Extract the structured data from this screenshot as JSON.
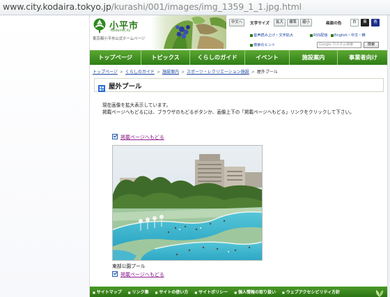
{
  "browser": {
    "url_host": "www.city.kodaira.tokyo.jp",
    "url_path": "/kurashi/001/images/img_1359_1_1.jpg.html"
  },
  "header": {
    "city_name": "小平市",
    "city_roman": "KodairaCity",
    "subtitle": "東京都小平市公式ホームページ",
    "tools": {
      "lang_button": "中文へ",
      "font_size_label": "文字サイズ",
      "font_large": "拡大",
      "font_standard": "標準",
      "font_small": "縮小",
      "color_label": "画面の色",
      "color_white": "白",
      "color_black": "黒",
      "color_blue": "青",
      "link_voice": "音声読み上げ・文字拡大",
      "link_rss": "RSS配信",
      "link_lang": "English・中文・韓",
      "link_search_hint": "検索のヒント",
      "search_placeholder": "Google カスタム検索",
      "search_button": "検索"
    }
  },
  "nav": {
    "items": [
      "トップページ",
      "トピックス",
      "くらしのガイド",
      "イベント",
      "施設案内",
      "事業者向け"
    ]
  },
  "breadcrumb": {
    "items": [
      "トップページ",
      "くらしのガイド",
      "施設案内",
      "スポーツ・レクリエーション施設"
    ],
    "current": "屋外プール"
  },
  "page_title": "屋外プール",
  "notice": {
    "line1": "現在画像を拡大表示しています。",
    "line2": "掲載ページへもどるには、ブラウザのもどるボタンか、画像上下の「掲載ページへもどる」リンクをクリックして下さい。"
  },
  "back_link_label": "掲載ページへもどる",
  "photo_caption": "東部公園プール",
  "footer": {
    "items": [
      "サイトマップ",
      "リンク集",
      "サイトの使い方",
      "サイトポリシー",
      "個人情報の取り扱い",
      "ウェブアクセシビリティ方針"
    ]
  },
  "colors": {
    "nav_green": "#2f7d16",
    "link_blue": "#1a44a0",
    "visited_purple": "#8a1c8a"
  }
}
